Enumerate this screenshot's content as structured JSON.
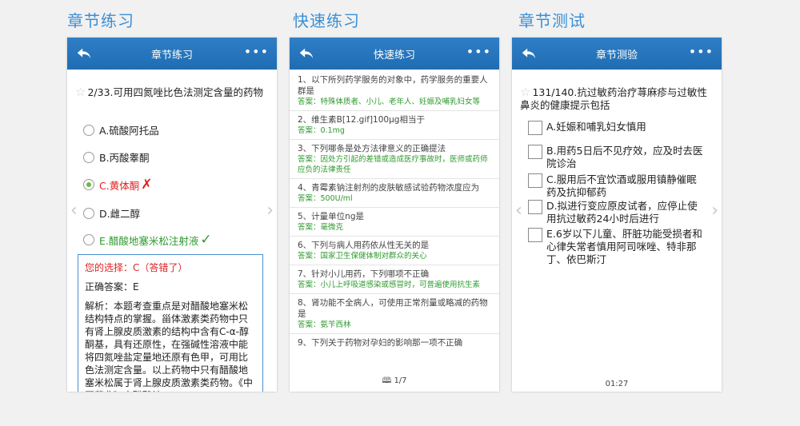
{
  "sections": {
    "chapter_practice": "章节练习",
    "quick_practice": "快速练习",
    "chapter_test": "章节测试"
  },
  "colors": {
    "accent": "#3a8fd6",
    "toolbar": "#2f7fc6",
    "correct": "#2e9a2e",
    "wrong": "#e02020"
  },
  "phone1": {
    "title": "章节练习",
    "menu": "•••",
    "question": "2/33.可用四氮唑比色法测定含量的药物",
    "options": [
      {
        "label": "A.硫酸阿托品"
      },
      {
        "label": "B.丙酸睾酮"
      },
      {
        "label": "C.黄体酮"
      },
      {
        "label": "D.雌二醇"
      },
      {
        "label": "E.醋酸地塞米松注射液"
      }
    ],
    "wrong_mark": "✗",
    "right_mark": "✓",
    "your_choice": "您的选择：C（答错了）",
    "correct_answer": "正确答案：E",
    "analysis": "解析：本题考查重点是对醋酸地塞米松结构特点的掌握。甾体激素类药物中只有肾上腺皮质激素的结构中含有C-α-醇酮基，具有还原性，在强碱性溶液中能将四氮唑盐定量地还原有色甲，可用比色法测定含量。以上药物中只有醋酸地塞米松属于肾上腺皮质激素类药物。《中国药典》中醋酸地"
  },
  "phone2": {
    "title": "快速练习",
    "menu": "•••",
    "items": [
      {
        "q": "1、以下所列药学服务的对象中，药学服务的重要人群是",
        "a": "答案：特殊体质者、小儿、老年人、妊娠及哺乳妇女等"
      },
      {
        "q": "2、维生素B[12.gif]100μg相当于",
        "a": "答案：0.1mg"
      },
      {
        "q": "3、下列哪条是处方法律意义的正确提法",
        "a": "答案：因处方引起的差错或造成医疗事故时，医师或药师应负的法律责任"
      },
      {
        "q": "4、青霉素钠注射剂的皮肤敏感试验药物浓度应为",
        "a": "答案：500U/ml"
      },
      {
        "q": "5、计量单位ng是",
        "a": "答案：毫微克"
      },
      {
        "q": "6、下列与病人用药依从性无关的是",
        "a": "答案：国家卫生保健体制对群众的关心"
      },
      {
        "q": "7、针对小儿用药，下列哪项不正确",
        "a": "答案：小儿上呼吸道感染或感冒时，可普遍使用抗生素"
      },
      {
        "q": "8、肾功能不全病人，可使用正常剂量或略减的药物是",
        "a": "答案：氨苄西林"
      },
      {
        "q": "9、下列关于药物对孕妇的影响那一项不正确",
        "a": ""
      }
    ],
    "pager": "1/7"
  },
  "phone3": {
    "title": "章节测验",
    "menu": "•••",
    "question": "131/140.抗过敏药治疗荨麻疹与过敏性鼻炎的健康提示包括",
    "options": [
      {
        "label": "A.妊娠和哺乳妇女慎用"
      },
      {
        "label": "B.用药5日后不见疗效，应及时去医院诊治"
      },
      {
        "label": "C.服用后不宜饮酒或服用镇静催眠药及抗抑郁药"
      },
      {
        "label": "D.拟进行变应原皮试者，应停止使用抗过敏药24小时后进行"
      },
      {
        "label": "E.6岁以下儿童、肝脏功能受损者和心律失常者慎用阿司咪唑、特非那丁、依巴斯汀"
      }
    ],
    "timer": "01:27"
  }
}
